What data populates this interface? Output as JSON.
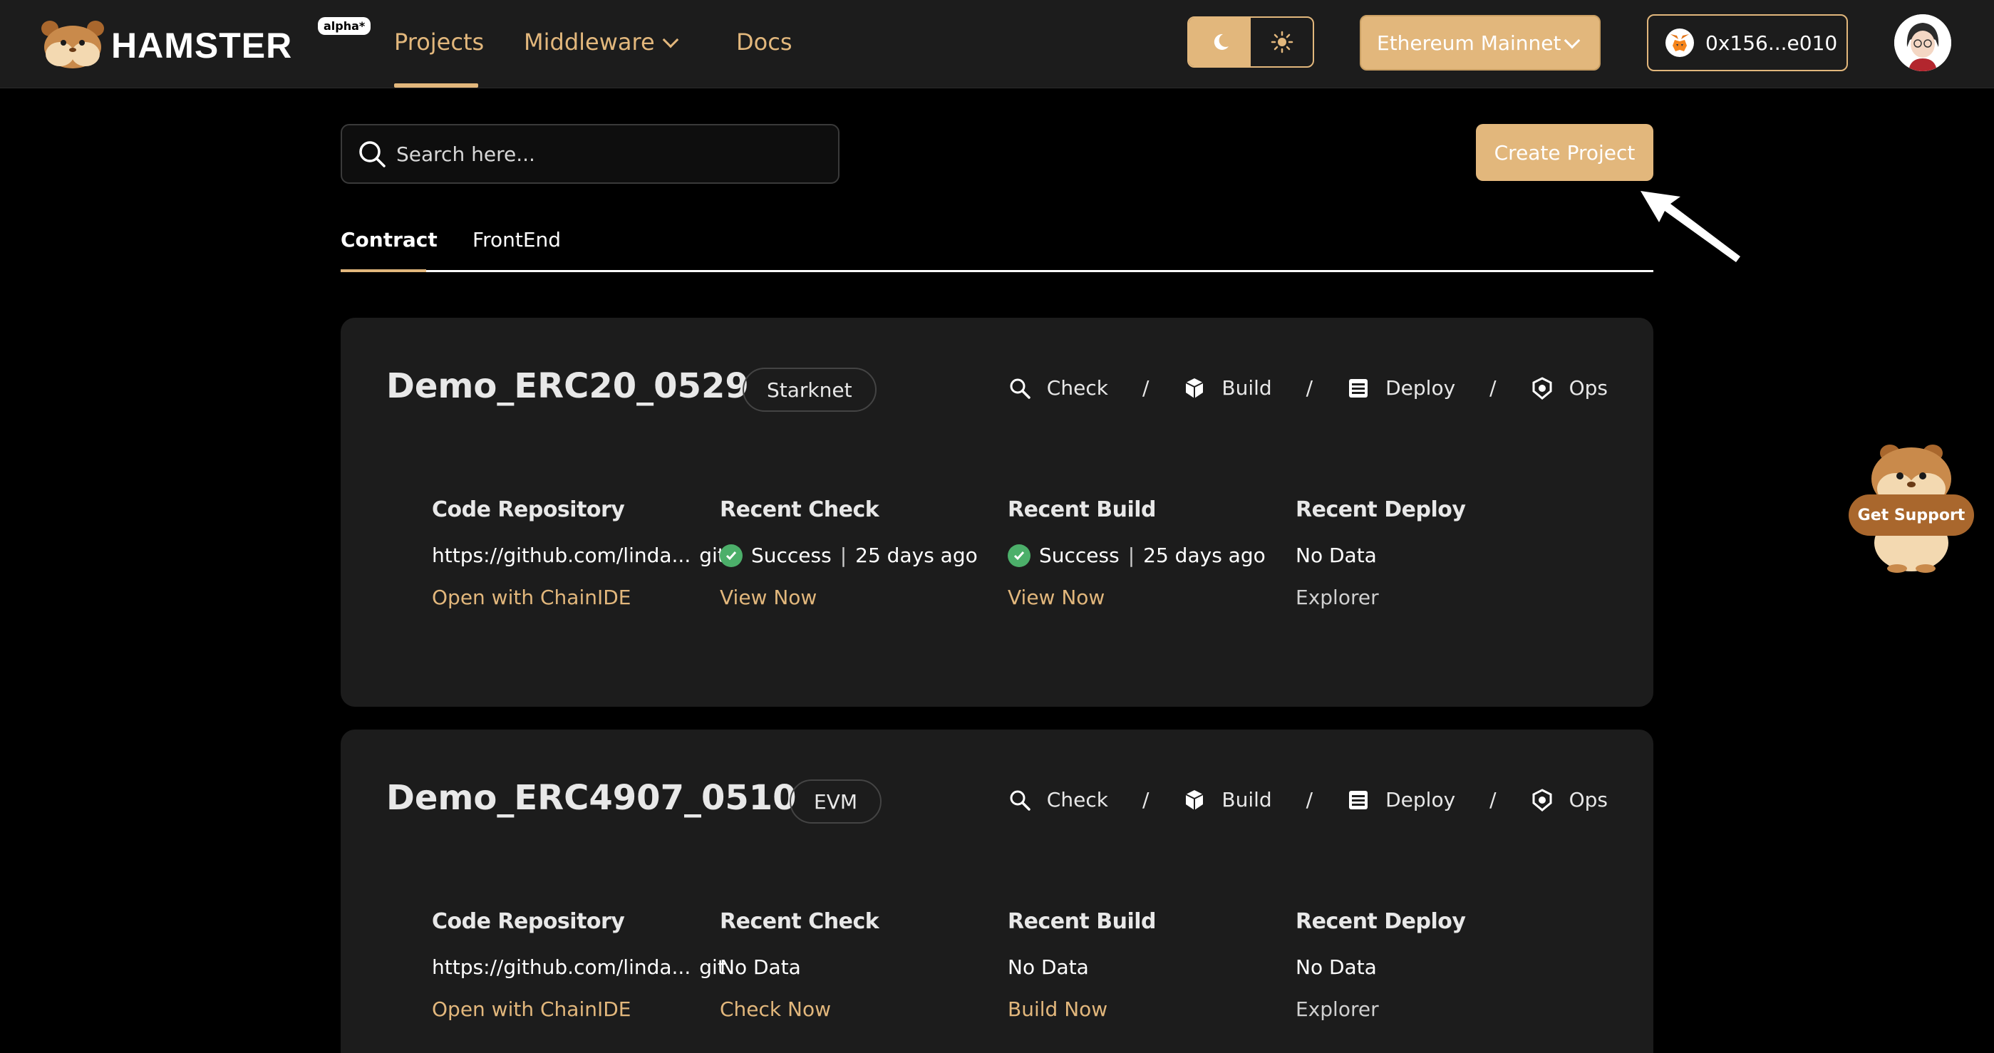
{
  "brand": {
    "name": "HAMSTER",
    "badge": "alpha*"
  },
  "nav": {
    "projects": "Projects",
    "middleware": "Middleware",
    "docs": "Docs"
  },
  "network": {
    "selected": "Ethereum Mainnet"
  },
  "wallet": {
    "address": "0x156...e010"
  },
  "search": {
    "placeholder": "Search here..."
  },
  "create_button": "Create Project",
  "tabs": [
    "Contract",
    "FrontEnd"
  ],
  "steps": [
    "Check",
    "Build",
    "Deploy",
    "Ops"
  ],
  "columns": {
    "repo": "Code Repository",
    "check": "Recent Check",
    "build": "Recent Build",
    "deploy": "Recent Deploy"
  },
  "projects": [
    {
      "name": "Demo_ERC20_0529",
      "chain": "Starknet",
      "repo": "https://github.com/linda...",
      "repo_suffix": "git",
      "repo_link": "Open with ChainIDE",
      "check_status": "Success",
      "check_time": "25 days ago",
      "check_link": "View Now",
      "build_status": "Success",
      "build_time": "25 days ago",
      "build_link": "View Now",
      "deploy_status": "No Data",
      "deploy_link": "Explorer"
    },
    {
      "name": "Demo_ERC4907_0510",
      "chain": "EVM",
      "repo": "https://github.com/linda...",
      "repo_suffix": "git",
      "repo_link": "Open with ChainIDE",
      "check_status": "No Data",
      "check_link": "Check Now",
      "build_status": "No Data",
      "build_link": "Build Now",
      "deploy_status": "No Data",
      "deploy_link": "Explorer"
    }
  ],
  "support": {
    "label": "Get Support"
  },
  "colors": {
    "accent": "#e2b77c",
    "success": "#4caf6a",
    "card": "#1c1c1c",
    "topbar": "#1c1c1c"
  },
  "icons": {
    "logo": "hamster-logo-icon",
    "theme_dark": "moon-icon",
    "theme_light": "sun-icon",
    "wallet": "metamask-fox-icon",
    "search": "search-icon",
    "check": "magnifier-icon",
    "build": "build-icon",
    "deploy": "deploy-icon",
    "ops": "ops-icon"
  }
}
